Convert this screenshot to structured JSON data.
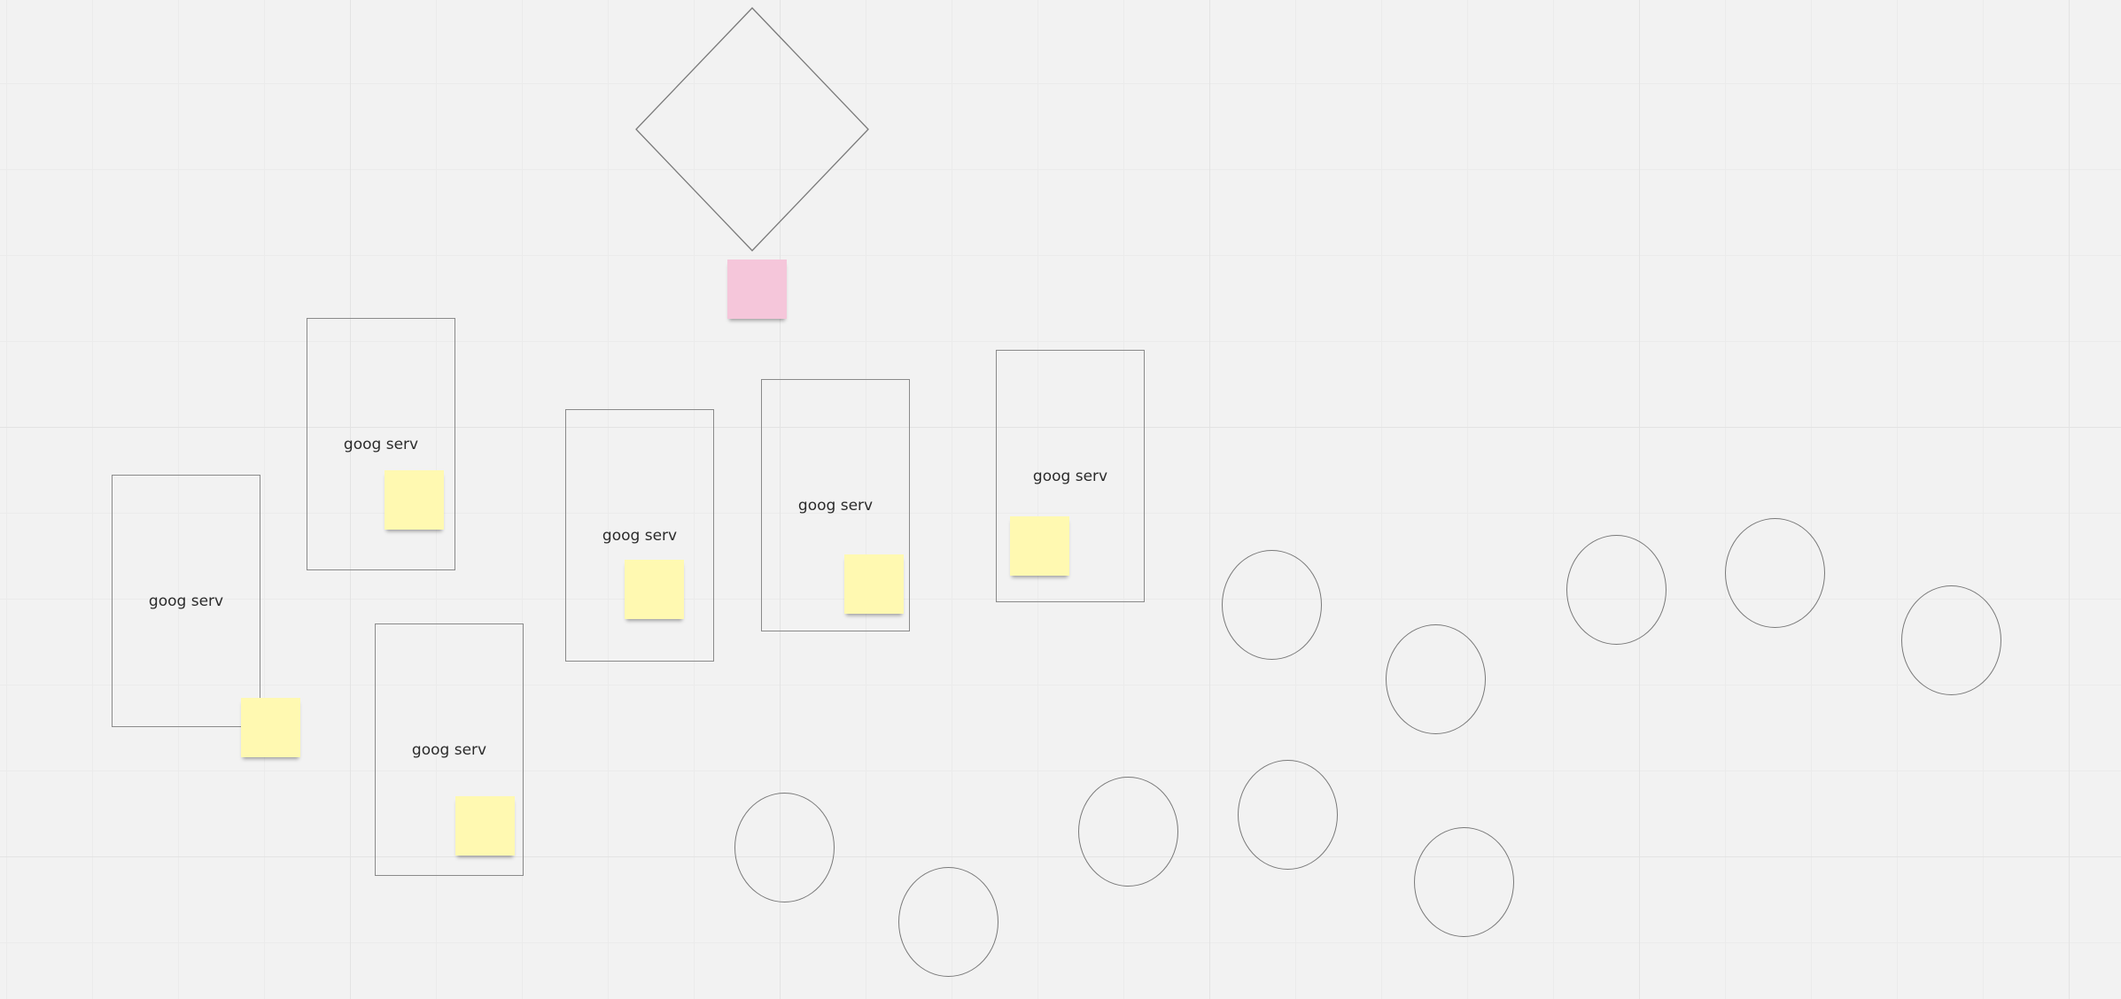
{
  "board": {
    "servers": [
      {
        "label": "goog serv"
      },
      {
        "label": "goog serv"
      },
      {
        "label": "goog serv"
      },
      {
        "label": "goog serv"
      },
      {
        "label": "goog serv"
      },
      {
        "label": "goog serv"
      }
    ],
    "sticky_colors": {
      "yellow": "#fff9b1",
      "pink": "#f5c6da"
    },
    "canvas_background": "#f2f2f2",
    "grid_line_color": "#e3e3e3"
  }
}
